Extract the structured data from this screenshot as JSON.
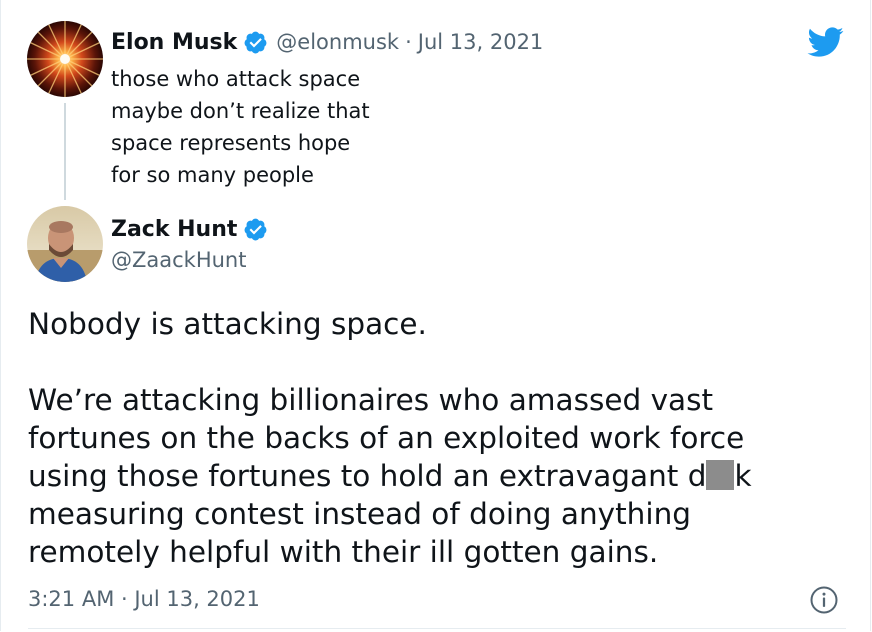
{
  "parent_tweet": {
    "display_name": "Elon Musk",
    "handle": "@elonmusk",
    "separator": "·",
    "date": "Jul 13, 2021",
    "text_lines": [
      "those who attack space",
      "maybe don’t realize that",
      "space represents hope",
      "for so many people"
    ],
    "verified_icon": "verified-badge-icon",
    "avatar_icon": "starburst-avatar"
  },
  "main_tweet": {
    "display_name": "Zack Hunt",
    "handle": "@ZaackHunt",
    "verified_icon": "verified-badge-icon",
    "avatar_icon": "person-photo-avatar",
    "paragraph_1": "Nobody is attacking space.",
    "paragraph_2_lines": [
      "We’re attacking billionaires who amassed vast",
      "fortunes on the backs of an exploited work force",
      "measuring contest instead of doing anything",
      "remotely helpful with their ill gotten gains."
    ],
    "censored_line_before": "using those fortunes to hold an extravagant d",
    "censored_line_after": "k",
    "timestamp": "3:21 AM · Jul 13, 2021"
  },
  "icons": {
    "brand": "twitter-bird-icon",
    "info": "info-icon"
  },
  "colors": {
    "verified_blue": "#1d9bf0",
    "twitter_blue": "#1d9bf0",
    "secondary_text": "#536471",
    "primary_text": "#0f1419",
    "thread_line": "#cfd9de",
    "censor_block": "#8c8c8c"
  }
}
